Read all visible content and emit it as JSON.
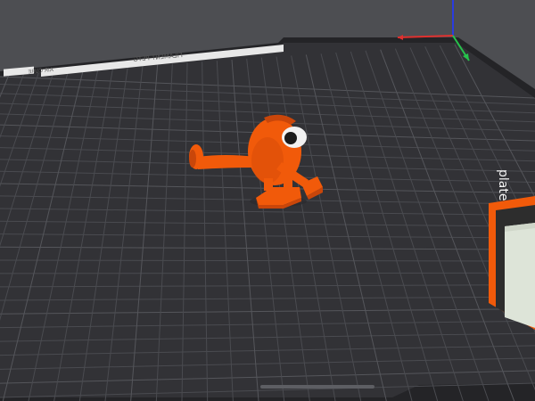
{
  "viewport": {
    "background": "#4d4e52"
  },
  "bed": {
    "name": "print-bed",
    "surface_color": "#323236",
    "edge_color": "#242427",
    "grid_color": "#4a4b50",
    "grid_major_color": "#55565b",
    "label_strip": {
      "text_left": "AIR CURE",
      "text_right": "FILAMENT PETG"
    },
    "side_label": "plate"
  },
  "axes": {
    "x_color": "#e0302e",
    "y_color": "#27c24c",
    "z_color": "#2a3ce0"
  },
  "model": {
    "name": "orange-character",
    "color": "#f15a0a",
    "shade_color": "#c9460a",
    "eye_white": "#f1f1f1",
    "eye_pupil": "#1b1b1b"
  },
  "side_object": {
    "accent_color": "#f15a0a",
    "dark_color": "#2d2d2d",
    "light_color": "#dde4d8"
  }
}
